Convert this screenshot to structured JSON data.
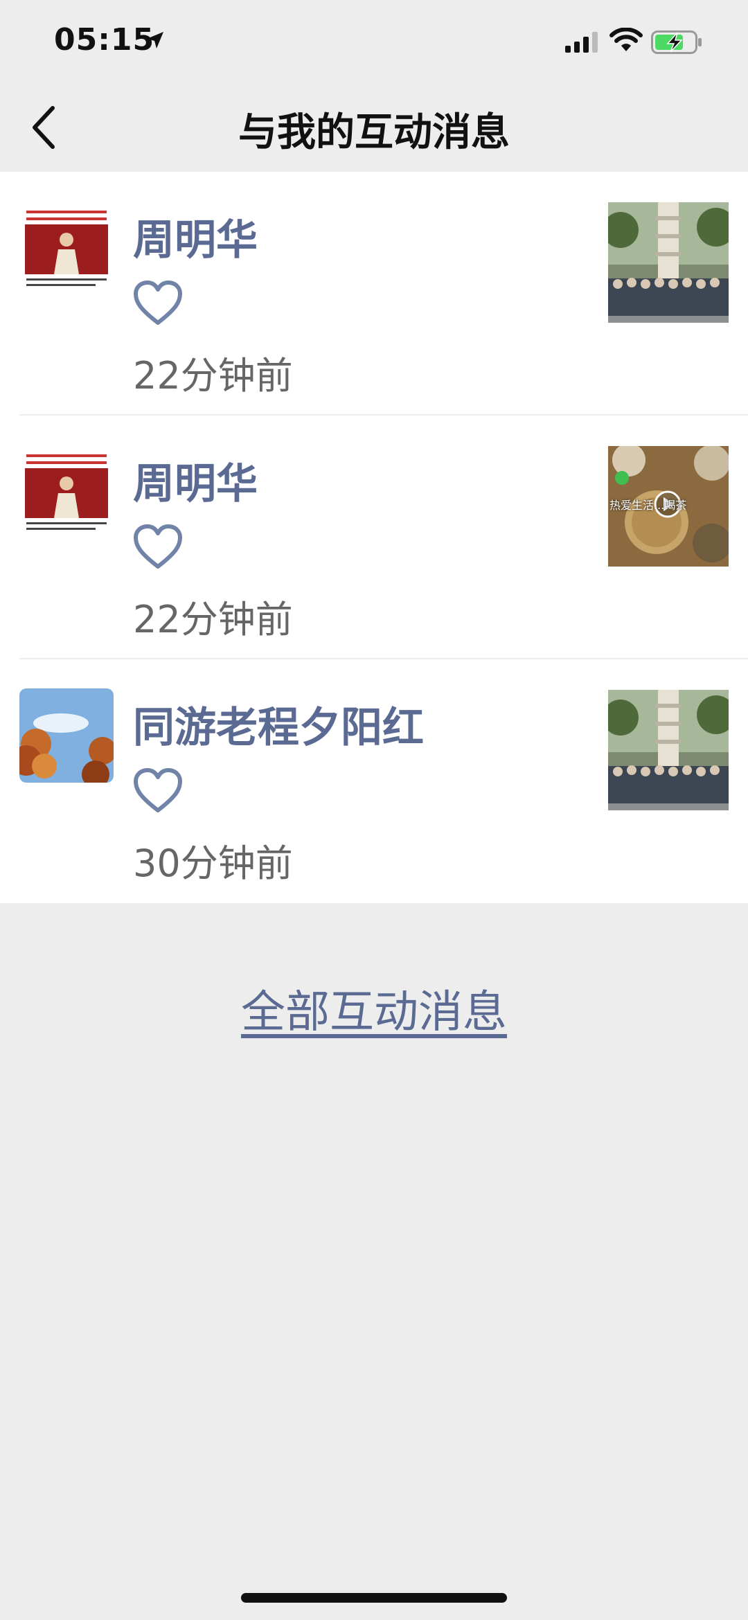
{
  "status": {
    "time": "05:15"
  },
  "nav": {
    "title": "与我的互动消息"
  },
  "messages": [
    {
      "user": "周明华",
      "time": "22分钟前",
      "thumb_overlay_text": ""
    },
    {
      "user": "周明华",
      "time": "22分钟前",
      "thumb_overlay_text": "热爱生活...喝茶"
    },
    {
      "user": "同游老程夕阳红",
      "time": "30分钟前",
      "thumb_overlay_text": ""
    }
  ],
  "footer": {
    "all_link": "全部互动消息"
  },
  "icons": {
    "back": "chevron-left-icon",
    "like": "heart-outline-icon",
    "signal": "signal-icon",
    "wifi": "wifi-icon",
    "battery": "battery-charging-icon",
    "location": "location-arrow-icon"
  },
  "colors": {
    "link_blue": "#5a6a92",
    "background": "#ededed",
    "battery_green": "#4cd964"
  }
}
